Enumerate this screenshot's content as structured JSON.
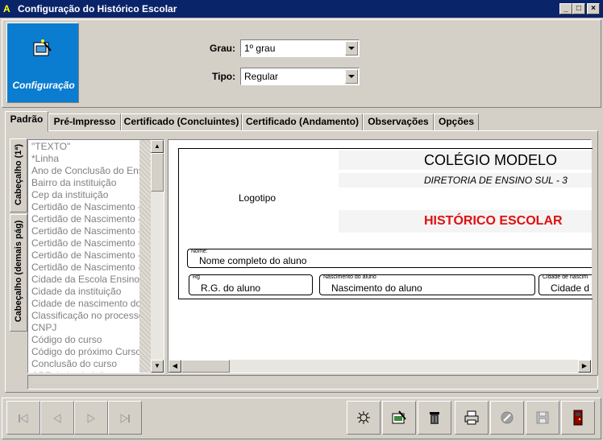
{
  "window": {
    "title": "Configuração do Histórico Escolar"
  },
  "config_button": {
    "label": "Configuração"
  },
  "form": {
    "grau_label": "Grau:",
    "grau_value": "1º grau",
    "tipo_label": "Tipo:",
    "tipo_value": "Regular"
  },
  "tabs": [
    "Padrão",
    "Pré-Impresso",
    "Certificado (Concluintes)",
    "Certificado (Andamento)",
    "Observações",
    "Opções"
  ],
  "vertical_tabs": [
    "Cabeçalho (1ª)",
    "Cabeçalho (demais pág)"
  ],
  "field_list": [
    "\"TEXTO\"",
    "*Linha",
    "Ano de Conclusão do Ensino",
    "Bairro da instituição",
    "Cep da instituição",
    "Certidão de Nascimento - C",
    "Certidão de Nascimento - D",
    "Certidão de Nascimento - F",
    "Certidão de Nascimento - L",
    "Certidão de Nascimento - N",
    "Certidão de Nascimento - U",
    "Cidade da Escola Ensino M",
    "Cidade da instituição",
    "Cidade de nascimento do a",
    "Classificação no processo",
    "CNPJ",
    "Código do curso",
    "Código do próximo Curso",
    "Conclusão do curso",
    "CPF da instituição"
  ],
  "header_preview": {
    "logo_label": "Logotipo",
    "school_name": "COLÉGIO MODELO",
    "directorate": "DIRETORIA DE ENSINO SUL - 3",
    "doc_title": "HISTÓRICO ESCOLAR",
    "name_caption": "Nome:",
    "name_value": "Nome completo do aluno",
    "rg_caption": "Rg",
    "rg_value": "R.G. do aluno",
    "birth_caption": "Nascimento do aluno",
    "birth_value": "Nascimento do aluno",
    "city_caption": "Cidade de nascim",
    "city_value": "Cidade d"
  },
  "colors": {
    "title_bar": "#0a246a",
    "config_button": "#0a7dd0",
    "doc_title": "#e01010"
  },
  "nav_icons": [
    "first-icon",
    "prev-icon",
    "next-icon",
    "last-icon"
  ],
  "action_icons": [
    "new-icon",
    "edit-icon",
    "delete-icon",
    "print-icon",
    "cancel-icon",
    "save-icon",
    "exit-icon"
  ]
}
